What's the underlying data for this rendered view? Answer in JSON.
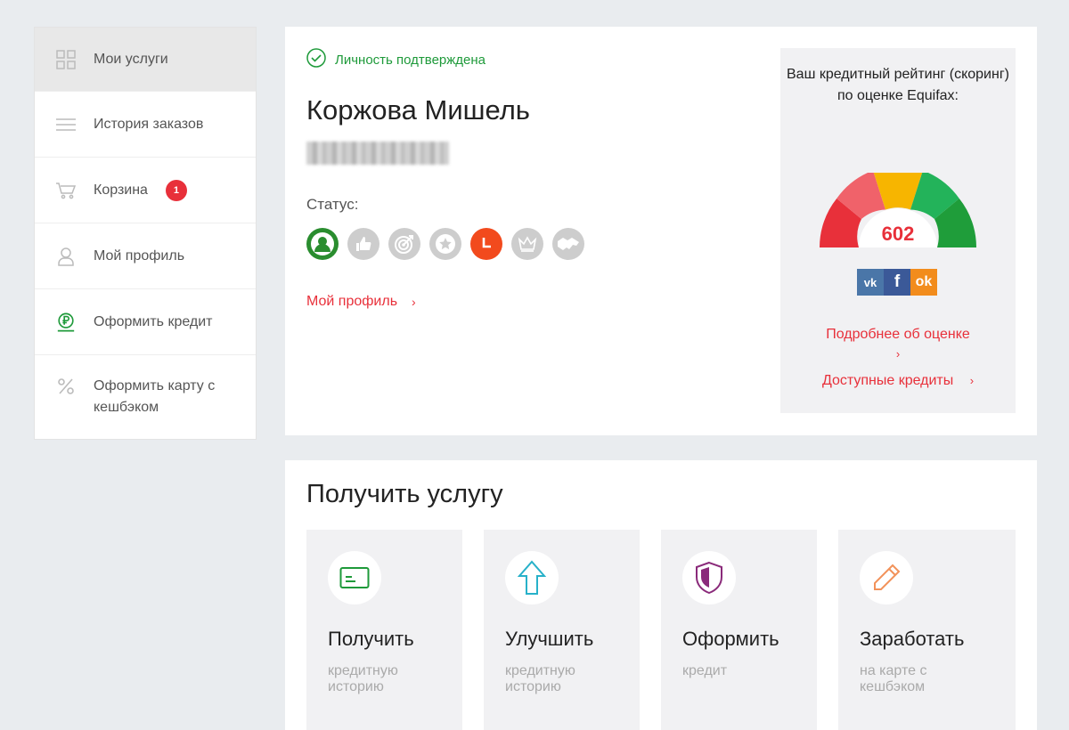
{
  "sidebar": {
    "items": [
      {
        "label": "Мои услуги",
        "icon": "grid-icon"
      },
      {
        "label": "История заказов",
        "icon": "list-icon"
      },
      {
        "label": "Корзина",
        "icon": "cart-icon",
        "badge": "1"
      },
      {
        "label": "Мой профиль",
        "icon": "user-icon"
      },
      {
        "label": "Оформить кредит",
        "icon": "ruble-icon"
      },
      {
        "label": "Оформить карту с кешбэком",
        "icon": "percent-icon"
      }
    ]
  },
  "profile": {
    "verified_text": "Личность подтверждена",
    "name": "Коржова Мишель",
    "status_label": "Статус:",
    "profile_link": "Мой профиль",
    "status_badges": [
      "user-badge",
      "thumbs-up-badge",
      "target-badge",
      "star-badge",
      "clock-badge",
      "crown-badge",
      "handshake-badge"
    ]
  },
  "credit": {
    "title": "Ваш кредитный рейтинг (скоринг) по оценке Equifax:",
    "score": "602",
    "more_link": "Подробнее об оценке",
    "loans_link": "Доступные кредиты",
    "socials": [
      {
        "name": "vk",
        "label": "vk"
      },
      {
        "name": "facebook",
        "label": "f"
      },
      {
        "name": "odnoklassniki",
        "label": "ok"
      }
    ]
  },
  "services": {
    "title": "Получить услугу",
    "tiles": [
      {
        "title": "Получить",
        "subtitle": "кредитную историю",
        "icon": "card-icon"
      },
      {
        "title": "Улучшить",
        "subtitle": "кредитную историю",
        "icon": "arrow-up-icon"
      },
      {
        "title": "Оформить",
        "subtitle": "кредит",
        "icon": "shield-icon"
      },
      {
        "title": "Заработать",
        "subtitle": "на карте с кешбэком",
        "icon": "pencil-icon"
      }
    ]
  },
  "colors": {
    "accent_red": "#e8303a",
    "verified_green": "#1e9a3a",
    "gauge": [
      "#e8303a",
      "#f0626a",
      "#f7b500",
      "#23b35a",
      "#1f9d3a"
    ]
  }
}
